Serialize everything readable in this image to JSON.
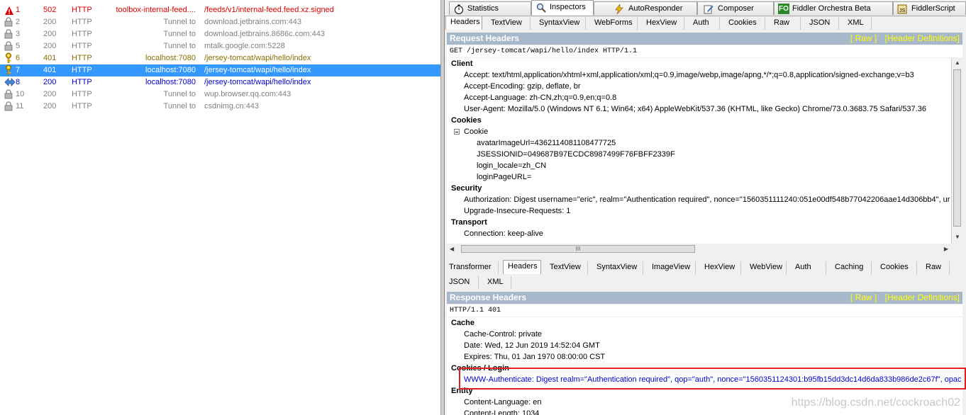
{
  "sessions": [
    {
      "num": "1",
      "result": "502",
      "protocol": "HTTP",
      "host": "toolbox-internal-feed....",
      "url": "/feeds/v1/internal-feed.feed.xz.signed",
      "style": "red",
      "icon": "error-triangle-icon"
    },
    {
      "num": "2",
      "result": "200",
      "protocol": "HTTP",
      "host": "Tunnel to",
      "url": "download.jetbrains.com:443",
      "style": "grey",
      "icon": "lock-icon"
    },
    {
      "num": "3",
      "result": "200",
      "protocol": "HTTP",
      "host": "Tunnel to",
      "url": "download.jetbrains.8686c.com:443",
      "style": "grey",
      "icon": "lock-icon"
    },
    {
      "num": "5",
      "result": "200",
      "protocol": "HTTP",
      "host": "Tunnel to",
      "url": "mtalk.google.com:5228",
      "style": "grey",
      "icon": "lock-icon"
    },
    {
      "num": "6",
      "result": "401",
      "protocol": "HTTP",
      "host": "localhost:7080",
      "url": "/jersey-tomcat/wapi/hello/index",
      "style": "olive",
      "icon": "key-icon"
    },
    {
      "num": "7",
      "result": "401",
      "protocol": "HTTP",
      "host": "localhost:7080",
      "url": "/jersey-tomcat/wapi/hello/index",
      "style": "sel",
      "icon": "key-icon"
    },
    {
      "num": "8",
      "result": "200",
      "protocol": "HTTP",
      "host": "localhost:7080",
      "url": "/jersey-tomcat/wapi/hello/index",
      "style": "blue",
      "icon": "arrows-icon"
    },
    {
      "num": "10",
      "result": "200",
      "protocol": "HTTP",
      "host": "Tunnel to",
      "url": "wup.browser.qq.com:443",
      "style": "grey",
      "icon": "lock-icon"
    },
    {
      "num": "11",
      "result": "200",
      "protocol": "HTTP",
      "host": "Tunnel to",
      "url": "csdnimg.cn:443",
      "style": "grey",
      "icon": "lock-icon"
    }
  ],
  "top_tabs": [
    {
      "label": "Statistics",
      "icon": "stopwatch-icon"
    },
    {
      "label": "Inspectors",
      "icon": "magnifier-icon"
    },
    {
      "label": "AutoResponder",
      "icon": "lightning-icon"
    },
    {
      "label": "Composer",
      "icon": "pencil-icon"
    },
    {
      "label": "Fiddler Orchestra Beta",
      "icon": "fo-icon",
      "icon_text": "FO"
    },
    {
      "label": "FiddlerScript",
      "icon": "script-icon"
    }
  ],
  "request_tabs": [
    "Headers",
    "TextView",
    "SyntaxView",
    "WebForms",
    "HexView",
    "Auth",
    "Cookies",
    "Raw",
    "JSON",
    "XML"
  ],
  "request": {
    "title": "Request Headers",
    "raw_link": "[ Raw ]",
    "defs_link": "[Header Definitions]",
    "request_line": "GET /jersey-tomcat/wapi/hello/index HTTP/1.1",
    "client_label": "Client",
    "accept": "Accept: text/html,application/xhtml+xml,application/xml;q=0.9,image/webp,image/apng,*/*;q=0.8,application/signed-exchange;v=b3",
    "accept_encoding": "Accept-Encoding: gzip, deflate, br",
    "accept_language": "Accept-Language: zh-CN,zh;q=0.9,en;q=0.8",
    "user_agent": "User-Agent: Mozilla/5.0 (Windows NT 6.1; Win64; x64) AppleWebKit/537.36 (KHTML, like Gecko) Chrome/73.0.3683.75 Safari/537.36",
    "cookies_label": "Cookies",
    "cookie_node": "Cookie",
    "cookie_1": "avatarImageUrl=4362114081108477725",
    "cookie_2": "JSESSIONID=049687B97ECDC8987499F76FBFF2339F",
    "cookie_3": "login_locale=zh_CN",
    "cookie_4": "loginPageURL=",
    "security_label": "Security",
    "authorization": "Authorization: Digest username=\"eric\", realm=\"Authentication required\", nonce=\"1560351111240:051e00df548b77042206aae14d306bb4\", ur",
    "upgrade": "Upgrade-Insecure-Requests: 1",
    "transport_label": "Transport",
    "connection": "Connection: keep-alive",
    "scroll_grip": "III"
  },
  "response_tabs_row1": [
    "Transformer",
    "Headers",
    "TextView",
    "SyntaxView",
    "ImageView",
    "HexView",
    "WebView",
    "Auth",
    "Caching",
    "Cookies",
    "Raw"
  ],
  "response_tabs_row2": [
    "JSON",
    "XML"
  ],
  "response": {
    "title": "Response Headers",
    "raw_link": "[ Raw ]",
    "defs_link": "[Header Definitions]",
    "status_line": "HTTP/1.1 401",
    "cache_label": "Cache",
    "cache_control": "Cache-Control: private",
    "date": "Date: Wed, 12 Jun 2019 14:52:04 GMT",
    "expires": "Expires: Thu, 01 Jan 1970 08:00:00 CST",
    "cookies_login_label": "Cookies / Login",
    "www_auth": "WWW-Authenticate: Digest realm=\"Authentication required\", qop=\"auth\", nonce=\"1560351124301:b95fb15dd3dc14d6da833b986de2c67f\", opac",
    "entity_label": "Entity",
    "content_language": "Content-Language: en",
    "content_length": "Content-Length: 1034"
  },
  "watermark": "https://blog.csdn.net/cockroach02",
  "colors": {
    "selected_row": "#3399ff",
    "header_bar": "#a8b8cb",
    "link_yellow": "#ffff00",
    "highlight_box": "#e02020",
    "error_red": "#e00000",
    "olive": "#8a7000",
    "link_blue": "#0000cc"
  }
}
